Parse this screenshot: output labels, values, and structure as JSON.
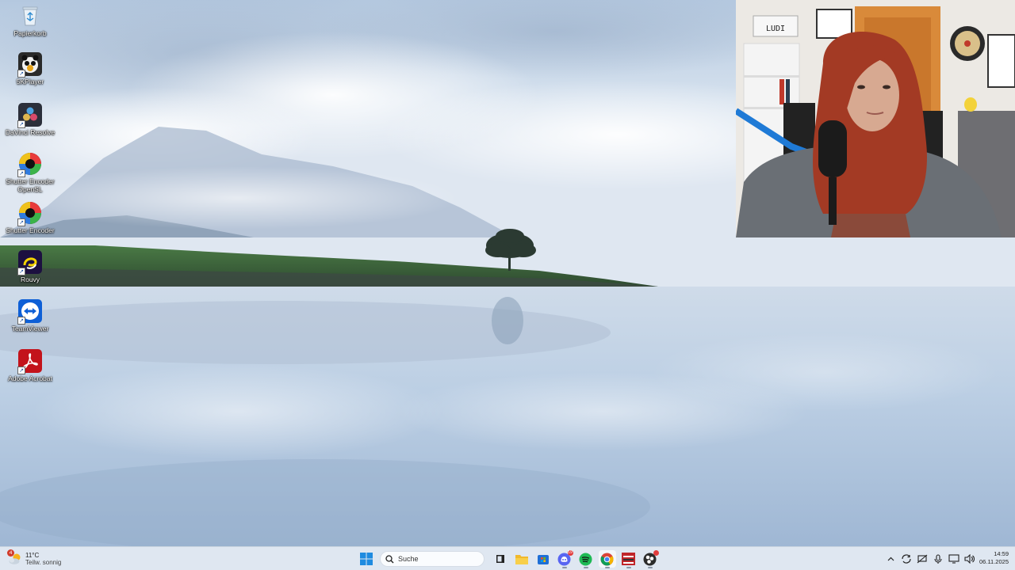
{
  "desktop": {
    "icons": [
      {
        "label": "Papierkorb",
        "icon": "recycle-bin-icon"
      },
      {
        "label": "5KPlayer",
        "icon": "5kplayer-icon"
      },
      {
        "label": "DaVinci Resolve",
        "icon": "davinci-resolve-icon"
      },
      {
        "label": "Shutter Encoder OpenSL",
        "icon": "shutter-encoder-opensl-icon"
      },
      {
        "label": "Shutter Encoder",
        "icon": "shutter-encoder-icon"
      },
      {
        "label": "Rouvy",
        "icon": "rouvy-icon"
      },
      {
        "label": "TeamViewer",
        "icon": "teamviewer-icon"
      },
      {
        "label": "Adobe Acrobat",
        "icon": "adobe-acrobat-icon"
      }
    ]
  },
  "webcam": {
    "sign_text": "LUDI"
  },
  "taskbar": {
    "weather": {
      "temperature": "11°C",
      "condition": "Teilw. sonnig",
      "badge": "4"
    },
    "search_placeholder": "Suche",
    "pinned": [
      "windows-start-icon",
      "search-icon",
      "task-view-icon",
      "file-explorer-icon",
      "microsoft-store-icon",
      "discord-icon",
      "spotify-icon",
      "chrome-icon",
      "media-app-icon",
      "obs-icon"
    ],
    "discord_badge": "19",
    "tray": [
      "show-hidden-icons-chevron",
      "onedrive-sync-icon",
      "network-off-icon",
      "microphone-icon",
      "display-icon",
      "volume-icon"
    ],
    "clock": {
      "time": "14:59",
      "date": "06.11.2025"
    }
  },
  "colors": {
    "taskbar_bg": "#dfe7f1",
    "accent_blue": "#1f6fd6",
    "notification_red": "#e23d3d"
  }
}
